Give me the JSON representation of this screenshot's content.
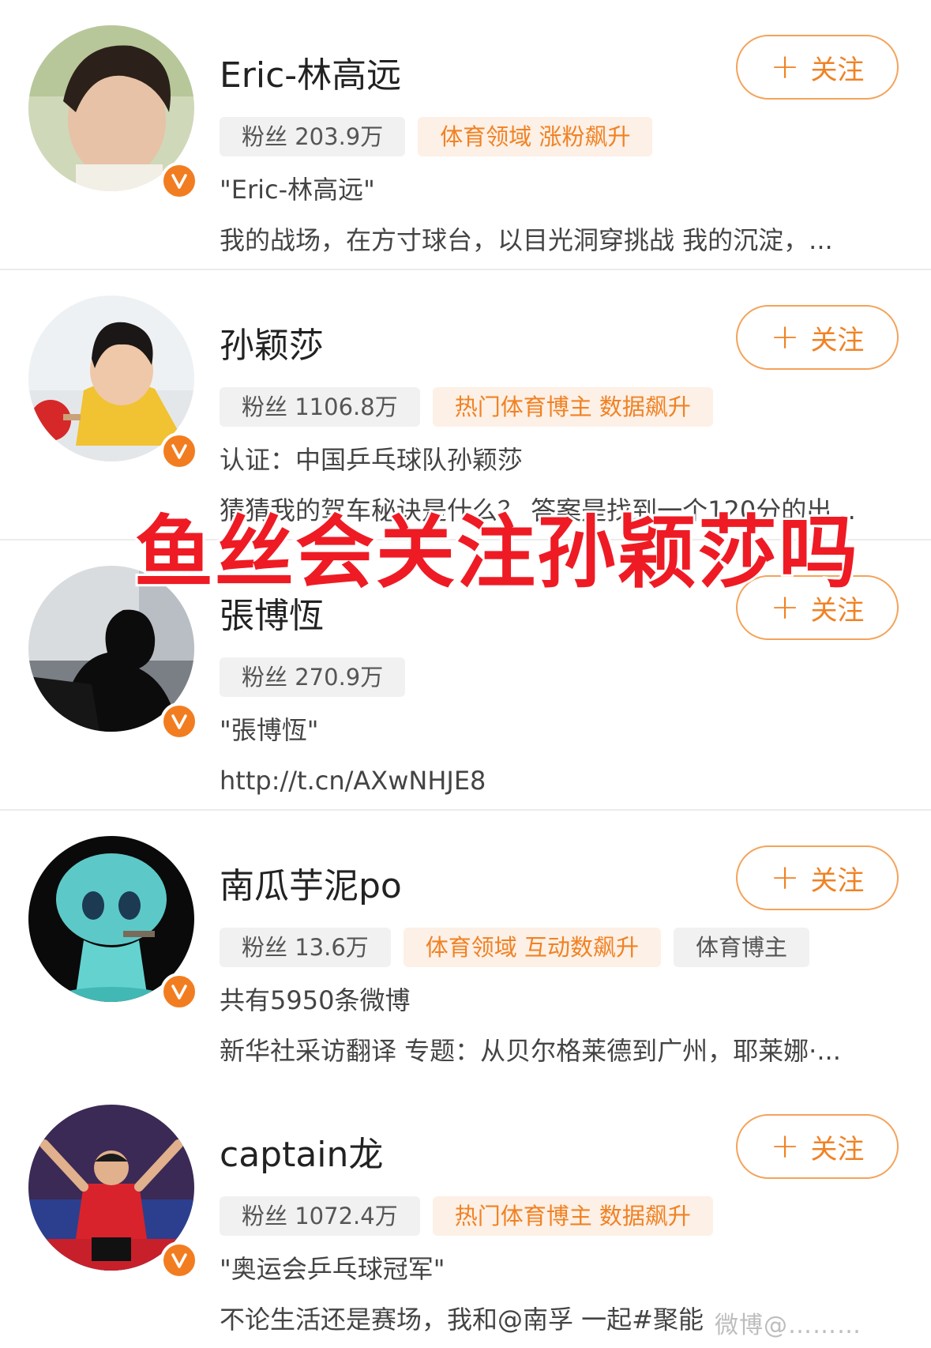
{
  "follow_label": "关注",
  "overlay_text": "鱼丝会关注孙颖莎吗",
  "watermark_text": "微博@………",
  "colors": {
    "accent": "#f08224",
    "overlay_red": "#ee1b24",
    "badge": "#f27d20"
  },
  "users": [
    {
      "name": "Eric-林高远",
      "tags": [
        {
          "text": "粉丝 203.9万",
          "style": "gray"
        },
        {
          "text": "体育领域 涨粉飙升",
          "style": "orange"
        }
      ],
      "line1": "\"Eric-林高远\"",
      "line2": "我的战场，在方寸球台，以目光洞穿挑战 我的沉淀，..."
    },
    {
      "name": "孙颖莎",
      "tags": [
        {
          "text": "粉丝 1106.8万",
          "style": "gray"
        },
        {
          "text": "热门体育博主 数据飙升",
          "style": "orange"
        }
      ],
      "line1": "认证：中国乒乓球队孙颖莎",
      "line2": "猜猜我的驾车秘诀是什么？ 答案是找到一个120分的出..."
    },
    {
      "name": "張博恆",
      "tags": [
        {
          "text": "粉丝 270.9万",
          "style": "gray"
        }
      ],
      "line1": "\"張博恆\"",
      "line2": "http://t.cn/AXwNHJE8"
    },
    {
      "name": "南瓜芋泥po",
      "tags": [
        {
          "text": "粉丝 13.6万",
          "style": "gray"
        },
        {
          "text": "体育领域 互动数飙升",
          "style": "orange"
        },
        {
          "text": "体育博主",
          "style": "gray"
        }
      ],
      "line1": "共有5950条微博",
      "line2": "新华社采访翻译 专题：从贝尔格莱德到广州，耶莱娜·..."
    },
    {
      "name": "captain龙",
      "tags": [
        {
          "text": "粉丝 1072.4万",
          "style": "gray"
        },
        {
          "text": "热门体育博主 数据飙升",
          "style": "orange"
        }
      ],
      "line1": "\"奥运会乒乓球冠军\"",
      "line2": "不论生活还是赛场，我和@南孚 一起#聚能"
    }
  ]
}
